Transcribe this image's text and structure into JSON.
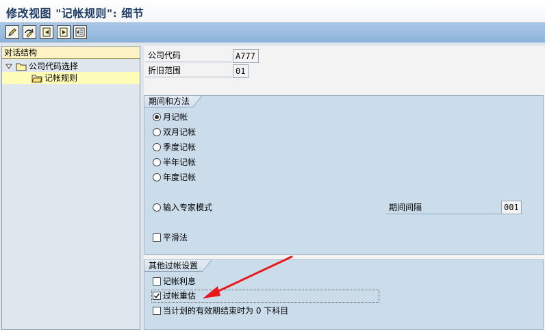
{
  "window": {
    "title": "修改视图 \"记帐规则\": 细节"
  },
  "toolbar": {
    "buttons": [
      {
        "icon": "pencil-icon"
      },
      {
        "icon": "display-change-icon"
      },
      {
        "icon": "previous-entry-icon"
      },
      {
        "icon": "next-entry-icon"
      },
      {
        "icon": "list-icon"
      }
    ]
  },
  "nav": {
    "header": "对话结构",
    "items": [
      {
        "label": "公司代码选择",
        "expanded": true
      },
      {
        "label": "记帐规则",
        "selected": true
      }
    ]
  },
  "fields": {
    "company_code": {
      "label": "公司代码",
      "value": "A777"
    },
    "depreciation_area": {
      "label": "折旧范围",
      "value": "01"
    }
  },
  "period_group": {
    "title": "期间和方法",
    "options": [
      {
        "label": "月记帐",
        "selected": true
      },
      {
        "label": "双月记帐",
        "selected": false
      },
      {
        "label": "季度记帐",
        "selected": false
      },
      {
        "label": "半年记帐",
        "selected": false
      },
      {
        "label": "年度记帐",
        "selected": false
      }
    ],
    "expert_mode": {
      "label": "输入专家模式",
      "selected": false
    },
    "period_interval": {
      "label": "期间间隔",
      "value": "001"
    },
    "smoothing": {
      "label": "平滑法",
      "checked": false
    }
  },
  "other_group": {
    "title": "其他过帐设置",
    "options": [
      {
        "label": "记帐利息",
        "checked": false
      },
      {
        "label": "过帐重估",
        "checked": true
      },
      {
        "label": "当计划的有效期结束时为 0 下科目",
        "checked": false
      }
    ]
  },
  "annotation": {
    "arrow_color": "#e8171a"
  }
}
